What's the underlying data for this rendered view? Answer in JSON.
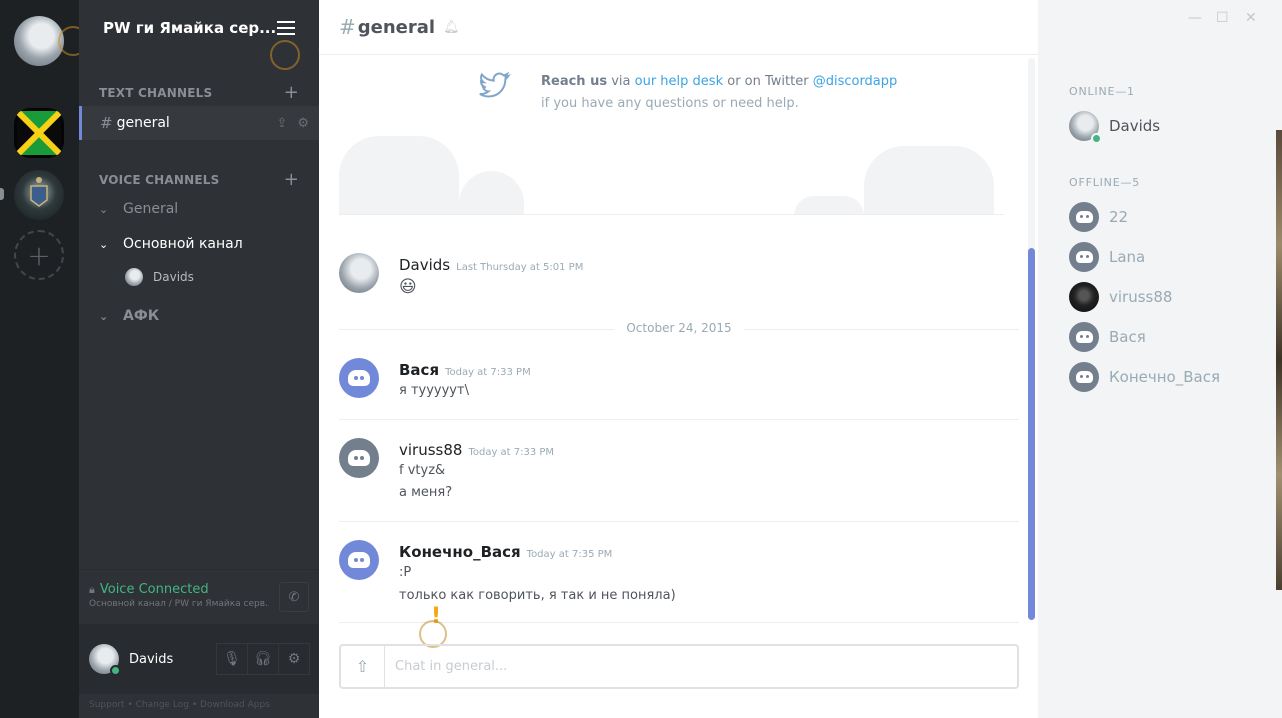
{
  "server_rail": {
    "add_server_icon": "plus-icon"
  },
  "sidebar": {
    "guild_name": "PW ги Ямайка сер...",
    "text_category": "TEXT CHANNELS",
    "active_channel": "general",
    "active_channel_hash": "#",
    "voice_category": "VOICE CHANNELS",
    "voice_channels": [
      {
        "name": "General",
        "expanded": false
      },
      {
        "name": "Основной канал",
        "expanded": true
      },
      {
        "name": "АФК",
        "expanded": false
      }
    ],
    "voice_user": "Davids",
    "voice_status": "Voice Connected",
    "voice_sub": "Основной канал / PW ги Ямайка серв...",
    "user_name": "Davids",
    "footer": "Support  •  Change Log  •  Download Apps"
  },
  "chat": {
    "hash": "#",
    "title": "general",
    "intro": {
      "reach": "Reach us",
      "via": " via ",
      "help_desk": "our help desk",
      "or_twitter": " or on Twitter ",
      "handle": "@discordapp",
      "line2": "if you have any questions or need help."
    },
    "messages": [
      {
        "author": "Davids",
        "time": "Last Thursday at 5:01 PM",
        "lines": [
          "😃"
        ]
      },
      {
        "author": "Вася",
        "time": "Today at 7:33 PM",
        "lines": [
          "я тууууут\\"
        ]
      },
      {
        "author": "viruss88",
        "time": "Today at 7:33 PM",
        "lines": [
          "f vtyz&",
          "а меня?"
        ]
      },
      {
        "author": "Конечно_Вася",
        "time": "Today at 7:35 PM",
        "lines": [
          ":P",
          "только как говорить, я так и не поняла)"
        ]
      }
    ],
    "date_divider": "October 24, 2015",
    "composer_placeholder": "Chat in general..."
  },
  "members": {
    "online_header": "ONLINE—1",
    "offline_header": "OFFLINE—5",
    "online": [
      {
        "name": "Davids"
      }
    ],
    "offline": [
      {
        "name": "22"
      },
      {
        "name": "Lana"
      },
      {
        "name": "viruss88"
      },
      {
        "name": "Вася"
      },
      {
        "name": "Конечно_Вася"
      }
    ]
  },
  "colors": {
    "accent": "#7289da",
    "online": "#43b581",
    "link": "#3aa3e3"
  }
}
